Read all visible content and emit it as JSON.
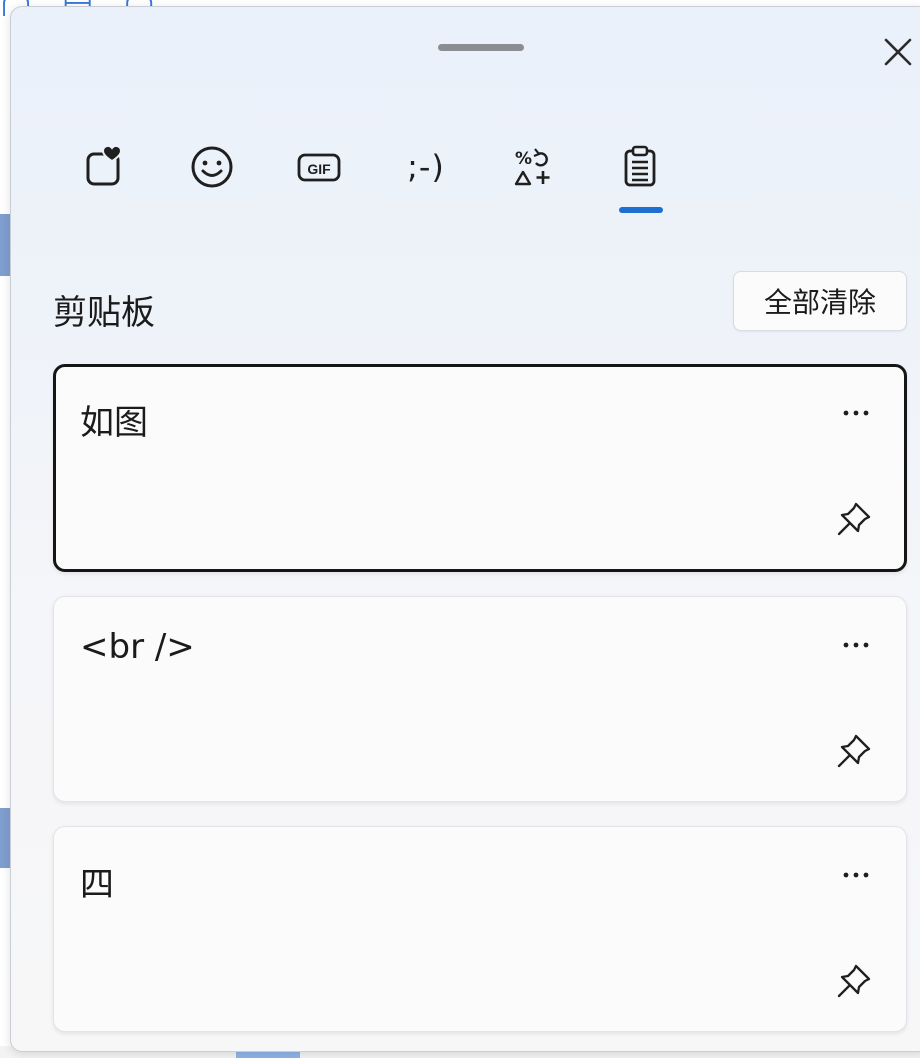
{
  "categories": [
    {
      "name": "favorites",
      "icon": "heart-icon"
    },
    {
      "name": "emoji",
      "icon": "smiley-icon"
    },
    {
      "name": "gif",
      "icon": "gif-icon",
      "label": "GIF"
    },
    {
      "name": "kaomoji",
      "icon": "kaomoji-icon",
      "label": ";-)"
    },
    {
      "name": "symbols",
      "icon": "symbols-icon"
    },
    {
      "name": "clipboard",
      "icon": "clipboard-icon",
      "selected": true
    }
  ],
  "clipboard": {
    "title": "剪贴板",
    "clear_all_label": "全部清除",
    "items": [
      {
        "text": "如图",
        "selected": true
      },
      {
        "text": "<br />",
        "selected": false
      },
      {
        "text": "四",
        "selected": false
      }
    ]
  },
  "colors": {
    "accent": "#1d6fd1",
    "text": "#1b1b1b",
    "card": "#fbfbfb"
  }
}
